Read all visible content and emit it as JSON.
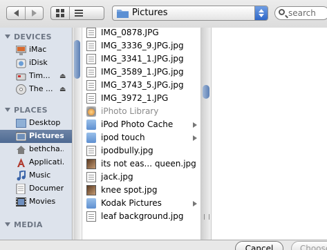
{
  "toolbar": {
    "location": "Pictures",
    "search_placeholder": "search"
  },
  "sidebar": {
    "sections": {
      "devices": "DEVICES",
      "places": "PLACES",
      "media": "MEDIA"
    },
    "devices": [
      {
        "label": "iMac",
        "icon": "imac-icon"
      },
      {
        "label": "iDisk",
        "icon": "idisk-icon"
      },
      {
        "label": "Tim...",
        "icon": "disk-icon"
      },
      {
        "label": "The ...",
        "icon": "cd-icon"
      }
    ],
    "places": [
      {
        "label": "Desktop",
        "icon": "desktop-icon"
      },
      {
        "label": "Pictures",
        "icon": "pictures-icon",
        "selected": true
      },
      {
        "label": "bethcha...",
        "icon": "home-icon"
      },
      {
        "label": "Applicati...",
        "icon": "applications-icon"
      },
      {
        "label": "Music",
        "icon": "music-icon"
      },
      {
        "label": "Documents",
        "icon": "documents-icon"
      },
      {
        "label": "Movies",
        "icon": "movies-icon"
      }
    ]
  },
  "files": [
    {
      "name": "IMG_0878.JPG",
      "kind": "doc"
    },
    {
      "name": "IMG_3336_9.JPG.jpg",
      "kind": "doc"
    },
    {
      "name": "IMG_3341_1.JPG.jpg",
      "kind": "doc"
    },
    {
      "name": "IMG_3589_1.JPG.jpg",
      "kind": "doc"
    },
    {
      "name": "IMG_3743_5.JPG.jpg",
      "kind": "doc"
    },
    {
      "name": "IMG_3972_1.JPG",
      "kind": "doc"
    },
    {
      "name": "iPhoto Library",
      "kind": "iphoto",
      "dim": true
    },
    {
      "name": "iPod Photo Cache",
      "kind": "folder",
      "arrow": true
    },
    {
      "name": "ipod touch",
      "kind": "folder",
      "arrow": true
    },
    {
      "name": "ipodbully.jpg",
      "kind": "doc"
    },
    {
      "name": "its not eas... queen.jpg",
      "kind": "photo"
    },
    {
      "name": "jack.jpg",
      "kind": "doc"
    },
    {
      "name": "knee spot.jpg",
      "kind": "photo"
    },
    {
      "name": "Kodak Pictures",
      "kind": "folder",
      "arrow": true
    },
    {
      "name": "leaf background.jpg",
      "kind": "doc"
    }
  ],
  "buttons": {
    "cancel": "Cancel",
    "choose": "Choose"
  }
}
